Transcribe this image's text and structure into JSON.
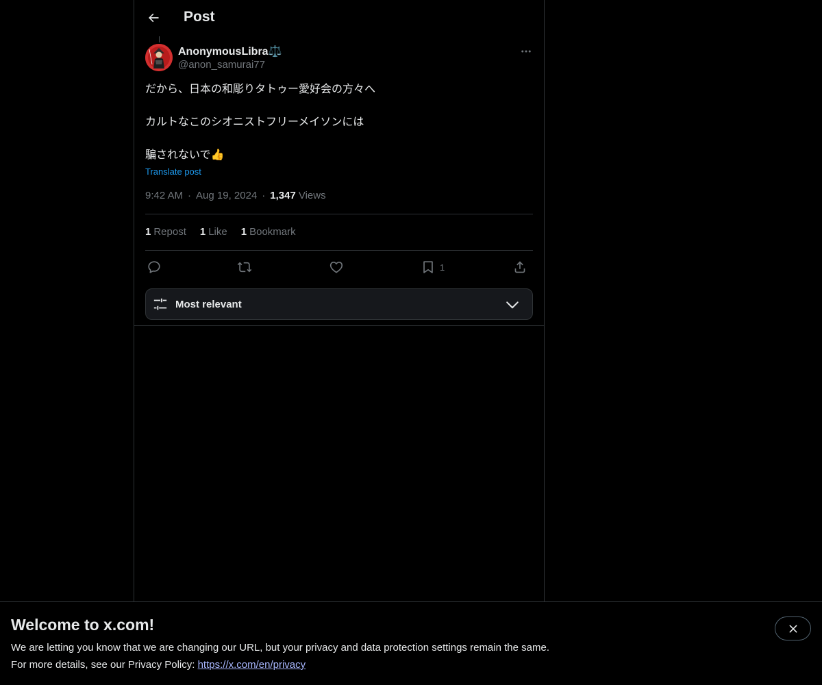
{
  "header": {
    "title": "Post",
    "back_icon": "arrow-left-icon"
  },
  "author": {
    "name": "AnonymousLibra⚖️",
    "handle": "@anon_samurai77",
    "avatar": "samurai-avatar"
  },
  "post": {
    "lines": [
      "だから、日本の和彫りタトゥー愛好会の方々へ",
      "カルトなこのシオニストフリーメイソンには",
      "騙されないで👍"
    ],
    "translate_label": "Translate post",
    "time": "9:42 AM",
    "separator": "·",
    "date": "Aug 19, 2024",
    "views_count": "1,347",
    "views_label": "Views"
  },
  "stats": {
    "reposts_count": "1",
    "reposts_label": "Repost",
    "likes_count": "1",
    "likes_label": "Like",
    "bookmarks_count": "1",
    "bookmarks_label": "Bookmark"
  },
  "actions": {
    "reply_icon": "reply-icon",
    "repost_icon": "repost-icon",
    "like_icon": "heart-icon",
    "bookmark_icon": "bookmark-icon",
    "bookmark_count": "1",
    "share_icon": "share-icon"
  },
  "sort": {
    "label": "Most relevant",
    "icon": "sliders-icon"
  },
  "banner": {
    "title": "Welcome to x.com!",
    "line1": "We are letting you know that we are changing our URL, but your privacy and data protection settings remain the same.",
    "line2_prefix": "For more details, see our Privacy Policy: ",
    "link": "https://x.com/en/privacy"
  },
  "colors": {
    "background": "#000000",
    "text": "#e7e9ea",
    "muted": "#71767b",
    "accent": "#1d9bf0",
    "border": "#2f3336"
  }
}
